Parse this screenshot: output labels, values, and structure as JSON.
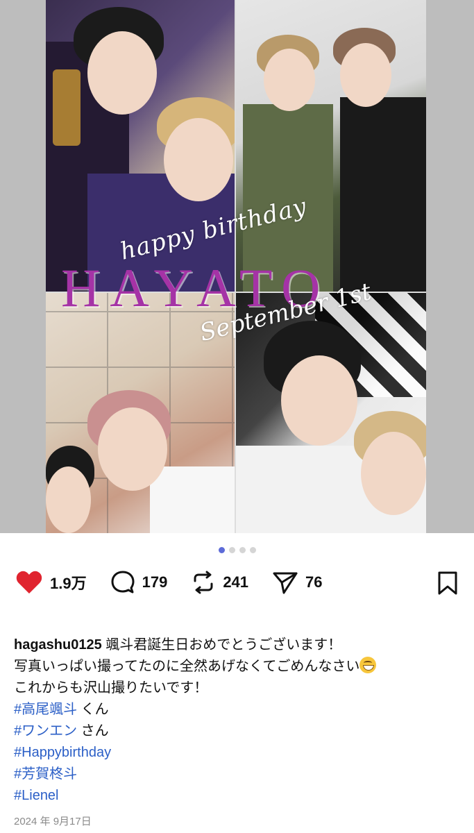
{
  "post": {
    "image_overlay": {
      "script_text": "happy birthday",
      "name_text": "HAYATO",
      "date_text": "September 1st"
    },
    "carousel": {
      "total": 4,
      "active": 1
    },
    "actions": {
      "like_count": "1.9万",
      "comment_count": "179",
      "repost_count": "241",
      "share_count": "76"
    },
    "caption": {
      "username": "hagashu0125",
      "line1_text": " 颯斗君誕生日おめでとうございます！",
      "line2_text": "写真いっぱい撮ってたのに全然あげなくてごめんなさい",
      "line3_text": "これからも沢山撮りたいです！",
      "tag1": "#高尾颯斗",
      "tag1_suffix": " くん",
      "tag2": "#ワンエン",
      "tag2_suffix": " さん",
      "tag3": "#Happybirthday",
      "tag4": "#芳賀柊斗",
      "tag5": "#Lienel"
    },
    "date": "2024 年 9月17日"
  },
  "colors": {
    "like": "#e0242f",
    "hashtag": "#2b5fc7",
    "overlay_name": "#a533a6",
    "dot_active": "#5d6bd8"
  }
}
